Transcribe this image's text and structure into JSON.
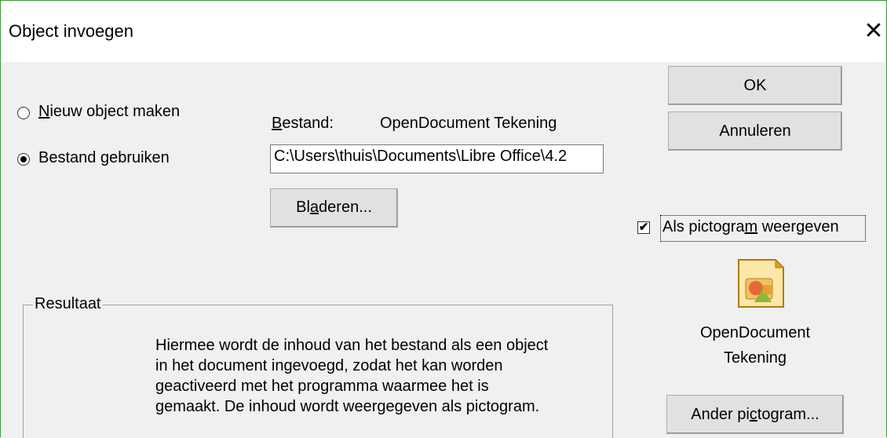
{
  "dialog": {
    "title": "Object invoegen",
    "close_glyph": "✕"
  },
  "options": {
    "new_object": {
      "pre": "",
      "mnemonic": "N",
      "post": "ieuw object maken",
      "selected": false
    },
    "from_file": {
      "pre": "Bestand ",
      "mnemonic": "g",
      "post": "ebruiken",
      "selected": true
    }
  },
  "file": {
    "label_mnemonic": "B",
    "label_rest": "estand:",
    "type_name": "OpenDocument Tekening",
    "path_value": "C:\\Users\\thuis\\Documents\\Libre Office\\4.2"
  },
  "buttons": {
    "ok": "OK",
    "cancel": "Annuleren",
    "browse_pre": "Bl",
    "browse_mnemonic": "a",
    "browse_post": "deren...",
    "change_icon_pre": "Ander pi",
    "change_icon_mnemonic": "c",
    "change_icon_post": "togram..."
  },
  "display_as_icon": {
    "checked": true,
    "check_glyph": "✔",
    "pre": "Als pictogra",
    "mnemonic": "m",
    "post": " weergeven"
  },
  "icon": {
    "name": "opendocument-drawing-icon",
    "caption_line1": "OpenDocument",
    "caption_line2": "Tekening",
    "colors": {
      "page": "#fbe7a8",
      "fold": "#e0a020",
      "shape_red": "#e05a2a",
      "shape_green": "#8cb63c"
    }
  },
  "result": {
    "legend": "Resultaat",
    "lines": [
      "Hiermee wordt de inhoud van het bestand als een object",
      "in het document ingevoegd, zodat het kan worden",
      "geactiveerd met het programma waarmee het is",
      "gemaakt. De inhoud wordt weergegeven als pictogram."
    ]
  }
}
